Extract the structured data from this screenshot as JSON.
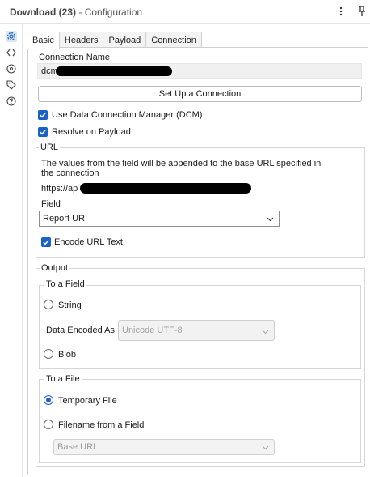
{
  "window": {
    "title_bold": "Download (23)",
    "title_sub": "- Configuration"
  },
  "title_icons": [
    "more-vertical-icon",
    "pin-icon"
  ],
  "rail_icons": [
    "gear-icon",
    "code-icon",
    "settings-circle-icon",
    "tag-icon",
    "help-icon"
  ],
  "tabs": [
    {
      "label": "Basic",
      "active": true
    },
    {
      "label": "Headers",
      "active": false
    },
    {
      "label": "Payload",
      "active": false
    },
    {
      "label": "Connection",
      "active": false
    }
  ],
  "connection": {
    "label": "Connection Name",
    "value_prefix": "dcm:",
    "setup_button": "Set Up a Connection"
  },
  "options": {
    "use_dcm": {
      "label": "Use Data Connection Manager (DCM)",
      "checked": true
    },
    "resolve_payload": {
      "label": "Resolve on Payload",
      "checked": true
    }
  },
  "url": {
    "legend": "URL",
    "description": "The values from the field will be appended to the base URL specified in the connection",
    "base_prefix": "https://ap",
    "field_label": "Field",
    "field_value": "Report URI",
    "encode": {
      "label": "Encode URL Text",
      "checked": true
    }
  },
  "output": {
    "legend": "Output",
    "to_field": {
      "legend": "To a Field",
      "string_label": "String",
      "data_encoded_label": "Data Encoded As",
      "data_encoded_value": "Unicode UTF-8",
      "blob_label": "Blob"
    },
    "to_file": {
      "legend": "To a File",
      "temporary_label": "Temporary File",
      "filename_label": "Filename from a Field",
      "filename_value": "Base URL",
      "selected": "Temporary File"
    }
  },
  "colors": {
    "accent": "#1a62c7",
    "border": "#cfcfcf",
    "disabled_text": "#a0a0a0"
  }
}
